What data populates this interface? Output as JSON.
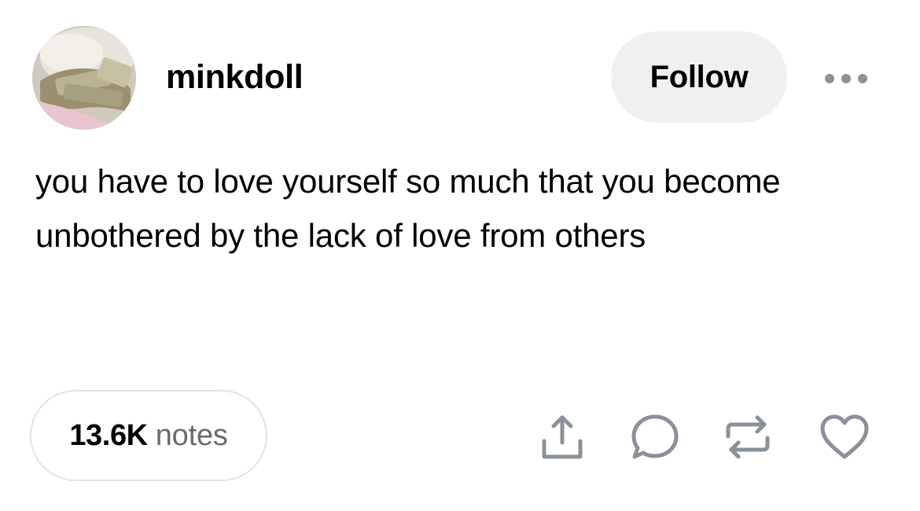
{
  "post": {
    "author": {
      "username": "minkdoll",
      "avatar_icon": "avatar-photo"
    },
    "follow_label": "Follow",
    "more_icon": "more-dots-icon",
    "text": "you have to love yourself so much that you become unbothered by the lack of love from others",
    "notes": {
      "count": "13.6K",
      "label": "notes"
    },
    "actions": [
      {
        "name": "share",
        "icon": "share-icon"
      },
      {
        "name": "reply",
        "icon": "reply-icon"
      },
      {
        "name": "reblog",
        "icon": "reblog-icon"
      },
      {
        "name": "like",
        "icon": "heart-icon"
      }
    ]
  },
  "colors": {
    "background": "#ffffff",
    "text": "#000000",
    "muted_text": "#6b6b6f",
    "icon": "#8a9199",
    "follow_bg": "#f0f0f2",
    "pill_border": "#e3e3e6"
  }
}
